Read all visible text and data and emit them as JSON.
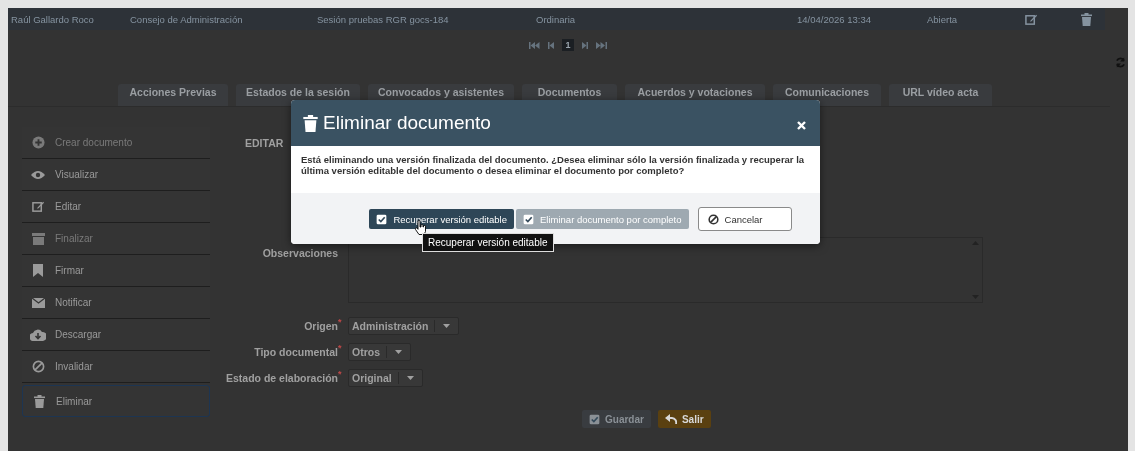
{
  "session_row": {
    "cells": [
      "Raúl Gallardo Roco",
      "Consejo de Administración",
      "Sesión pruebas RGR gocs-184",
      "Ordinaria",
      "14/04/2026 13:34",
      "Abierta"
    ]
  },
  "pagination": {
    "page": "1"
  },
  "tabs": [
    {
      "label": "Acciones Previas"
    },
    {
      "label": "Estados de la sesión"
    },
    {
      "label": "Convocados y asistentes"
    },
    {
      "label": "Documentos"
    },
    {
      "label": "Acuerdos y votaciones"
    },
    {
      "label": "Comunicaciones"
    },
    {
      "label": "URL vídeo acta"
    }
  ],
  "sidebar": {
    "items": [
      {
        "label": "Crear documento",
        "kind": "create",
        "disabled": true,
        "selected": false
      },
      {
        "label": "Visualizar",
        "kind": "view",
        "disabled": false,
        "selected": false
      },
      {
        "label": "Editar",
        "kind": "edit",
        "disabled": false,
        "selected": false
      },
      {
        "label": "Finalizar",
        "kind": "finish",
        "disabled": true,
        "selected": false
      },
      {
        "label": "Firmar",
        "kind": "sign",
        "disabled": false,
        "selected": false
      },
      {
        "label": "Notificar",
        "kind": "notify",
        "disabled": false,
        "selected": false
      },
      {
        "label": "Descargar",
        "kind": "download",
        "disabled": false,
        "selected": false
      },
      {
        "label": "Invalidar",
        "kind": "invalidate",
        "disabled": false,
        "selected": false
      },
      {
        "label": "Eliminar",
        "kind": "delete",
        "disabled": false,
        "selected": true
      }
    ]
  },
  "form": {
    "heading": "EDITAR",
    "fields": [
      {
        "label": "Observaciones",
        "kind": "textarea"
      },
      {
        "label": "Origen",
        "kind": "select",
        "value": "Administración",
        "required_mark": "*"
      },
      {
        "label": "Tipo documental",
        "kind": "select",
        "value": "Otros",
        "required_mark": "*"
      },
      {
        "label": "Estado de elaboración",
        "kind": "select",
        "value": "Original",
        "required_mark": "*"
      }
    ],
    "buttons": [
      {
        "label": "Guardar",
        "kind": "save",
        "disabled": true
      },
      {
        "label": "Salir",
        "kind": "exit",
        "disabled": false
      }
    ]
  },
  "dialog": {
    "title": "Eliminar documento",
    "message": "Está eliminando una versión finalizada del documento. ¿Desea eliminar sólo la versión finalizada y recuperar la última versión editable del documento o desea eliminar el documento por completo?",
    "buttons": [
      {
        "label": "Recuperar versión editable",
        "kind": "primary",
        "disabled": false
      },
      {
        "label": "Eliminar documento por completo",
        "kind": "danger",
        "disabled": true
      },
      {
        "label": "Cancelar",
        "kind": "cancel",
        "disabled": false
      }
    ],
    "tooltip": "Recuperar versión editable"
  }
}
